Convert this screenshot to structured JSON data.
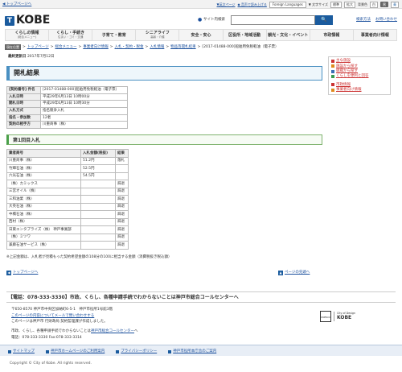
{
  "topbar": {
    "back_link": "◀ トップページへ",
    "english": "▼英文ページ",
    "read_aloud": "◆ 音声で読み上げる",
    "languages": "Foreign Languages",
    "color_label": "▼ 文字サイズ",
    "size_standard": "標準",
    "size_large": "拡大",
    "contrast_label": "背景色",
    "contrast_white": "白",
    "contrast_black": "黒",
    "contrast_blue": "青"
  },
  "header": {
    "logo_text": "KOBE",
    "logo_mark": "T",
    "search_label": "サイト内検索",
    "search_placeholder": "",
    "search_button": "🔍",
    "link_search_howto": "検索方法",
    "link_contact": "お問い合わせ"
  },
  "gnav": [
    {
      "label": "くらしの情報",
      "sub": "(総合メニュー)"
    },
    {
      "label": "くらし・手続き",
      "sub": "住まい・ゴミ・交通"
    },
    {
      "label": "子育て・教育",
      "sub": ""
    },
    {
      "label": "シニアライフ",
      "sub": "高齢・介護"
    },
    {
      "label": "安全・安心",
      "sub": ""
    },
    {
      "label": "区役所・地域活動",
      "sub": ""
    },
    {
      "label": "観光・文化・イベント",
      "sub": ""
    },
    {
      "label": "市政情報",
      "sub": ""
    },
    {
      "label": "事業者向け情報",
      "sub": ""
    }
  ],
  "breadcrumb": {
    "here": "現在位置",
    "items": [
      "トップページ",
      "総合メニュー",
      "事業者向け情報",
      "入札・契約・税金",
      "入札情報",
      "物品等開札結果"
    ],
    "current": "[2017-01488-000]船舶用免税軽油（電子票）"
  },
  "updated": {
    "label": "最終更新日",
    "date": "2017年7月12日"
  },
  "page_title": "開札結果",
  "info_table": [
    {
      "label": "[契約番号] 件名",
      "value": "[2017-01488-000]船舶用免税軽油（電子票）"
    },
    {
      "label": "入札日時",
      "value": "平成29年6月13日 10時00分"
    },
    {
      "label": "開札日時",
      "value": "平成29年6月13日 10時30分"
    },
    {
      "label": "入札方式",
      "value": "指名競争入札"
    },
    {
      "label": "指名・参加数",
      "value": "12者"
    },
    {
      "label": "契約の相手方",
      "value": "川重商事（株）"
    }
  ],
  "round_title": "第1回目入札",
  "bids": {
    "headers": [
      "業者商号",
      "入札金額(税抜)",
      "結果"
    ],
    "rows": [
      {
        "name": "川重商事（株）",
        "amount": "51.2円",
        "result": "落札"
      },
      {
        "name": "竹輝石油（株）",
        "amount": "52.5円",
        "result": ""
      },
      {
        "name": "六光石油（株）",
        "amount": "54.5円",
        "result": ""
      },
      {
        "name": "（株）カミックス",
        "amount": "",
        "result": "辞退"
      },
      {
        "name": "三宮オイル（株）",
        "amount": "",
        "result": "辞退"
      },
      {
        "name": "三和油業（株）",
        "amount": "",
        "result": "辞退"
      },
      {
        "name": "大英石油（株）",
        "amount": "",
        "result": "辞退"
      },
      {
        "name": "中橋石油（株）",
        "amount": "",
        "result": "辞退"
      },
      {
        "name": "西村（株）",
        "amount": "",
        "result": "辞退"
      },
      {
        "name": "日東エンタプライズ（株） 神戸事業部",
        "amount": "",
        "result": "辞退"
      },
      {
        "name": "（株）ミツワ",
        "amount": "",
        "result": "辞退"
      },
      {
        "name": "兼藤石油サービス（株）",
        "amount": "",
        "result": "辞退"
      }
    ]
  },
  "note": "※上記金額は、入札者が見積もった契約希望金額の108分の100に相当する金額（消費税抜き税込額）",
  "sidebar": [
    {
      "label": "主な施設",
      "icon": "square-red"
    },
    {
      "label": "施設から探す",
      "icon": "square-orange"
    },
    {
      "label": "組織から探す",
      "icon": "square-blue"
    },
    {
      "label": "くらしを便利と回答",
      "icon": "square-green"
    },
    {
      "label": "市政情報",
      "icon": "square-red"
    },
    {
      "label": "事業者向け情報",
      "icon": "square-orange"
    }
  ],
  "pager": {
    "prev": "トップページへ",
    "next": "ページの先頭へ"
  },
  "callcenter": "【電話：078-333-3330】市政、くらし、各種申請手続でわからないことは神戸市総合コールセンターへ",
  "footinfo": {
    "address": "〒650-8570 神戸市中央区加納町6-5-1　神戸市役所1号館3階",
    "link_address": "このページの内容についてメールで問い合わせする",
    "dept": "このページは神戸市 行財政局 契約監理課が作成しました。",
    "call": "市政、くらし、各種申請手続でわからないことは",
    "call_link": "神戸市総合コールセンター",
    "call_end": "へ",
    "phone": "電話：078-333-3330 Fax:078-333-3314"
  },
  "footlogo": {
    "unesco": "UNESCO",
    "design": "City of Design",
    "kobe": "KOBE"
  },
  "footnav": [
    "サイトマップ",
    "神戸市ホームページのご利用案内",
    "プライバシーポリシー",
    "神戸市役所本庁舎のご案内"
  ],
  "copyright": "Copyright © City of Kobe. All rights reserved."
}
